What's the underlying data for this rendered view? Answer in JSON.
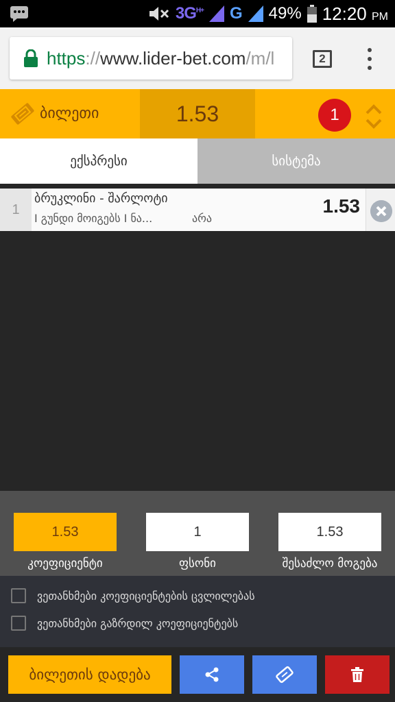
{
  "status_bar": {
    "network_1": "3G",
    "network_1_sup": "H+",
    "network_2": "G",
    "battery": "49%",
    "time": "12:20",
    "ampm": "PM"
  },
  "browser": {
    "url_scheme": "https",
    "url_sep": "://",
    "url_host": "www.lider-bet.com",
    "url_path": "/m/l",
    "tab_count": "2"
  },
  "ticket": {
    "title": "ბილეთი",
    "total_odds": "1.53",
    "bet_count": "1"
  },
  "tabs": [
    {
      "label": "ექსპრესი",
      "active": true
    },
    {
      "label": "სისტემა",
      "active": false
    }
  ],
  "bets": [
    {
      "index": "1",
      "match": "ბრუკლინი - შარლოტი",
      "market": "I გუნდი მოიგებს I ნა...",
      "outcome": "არა",
      "odds": "1.53"
    }
  ],
  "summary": {
    "odds_value": "1.53",
    "stake_value": "1",
    "win_value": "1.53",
    "odds_label": "კოეფიციენტი",
    "stake_label": "ფსონი",
    "win_label": "შესაძლო მოგება"
  },
  "options": [
    {
      "label": "ვეთანხმები კოეფიციენტების ცვლილებას",
      "checked": false
    },
    {
      "label": "ვეთანხმები გაზრდილ კოეფიციენტებს",
      "checked": false
    }
  ],
  "actions": {
    "place_bet": "ბილეთის დადება"
  },
  "colors": {
    "accent": "#ffb400",
    "accent_dark": "#e6a200",
    "share_blue": "#4a7ee6",
    "delete_red": "#c51d1d",
    "badge_red": "#d8141a"
  },
  "icons": {
    "ticket": "ticket-icon",
    "share": "share-icon",
    "delete": "trash-icon",
    "remove": "close-circle-icon",
    "toggle": "chevron-up-down-icon",
    "lock": "lock-icon"
  }
}
